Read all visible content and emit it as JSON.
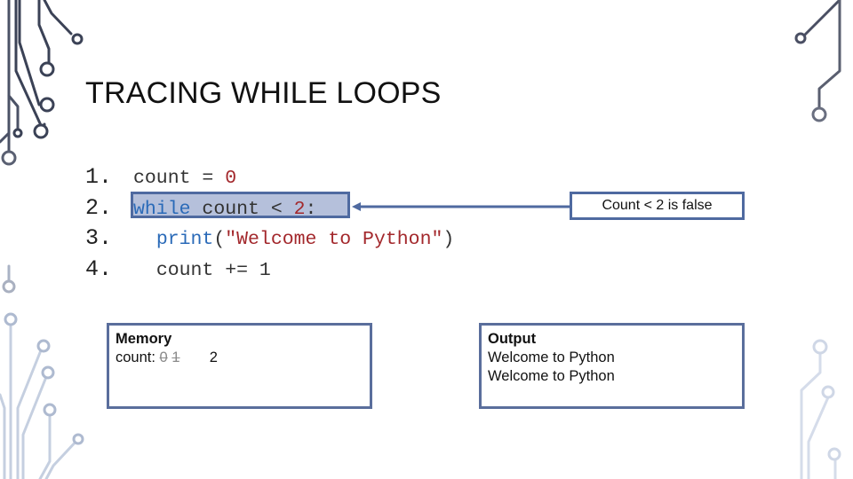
{
  "slide": {
    "title": "TRACING WHILE LOOPS"
  },
  "code": {
    "lines": [
      {
        "number": "1.",
        "indent": "",
        "parts": [
          {
            "text": "count = ",
            "kind": "plain"
          },
          {
            "text": "0",
            "kind": "num"
          }
        ]
      },
      {
        "number": "2.",
        "indent": "",
        "parts": [
          {
            "text": "while",
            "kind": "kw"
          },
          {
            "text": " count < ",
            "kind": "plain"
          },
          {
            "text": "2",
            "kind": "num"
          },
          {
            "text": ":",
            "kind": "plain"
          }
        ]
      },
      {
        "number": "3.",
        "indent": "  ",
        "parts": [
          {
            "text": "print",
            "kind": "kw"
          },
          {
            "text": "(",
            "kind": "plain"
          },
          {
            "text": "\"Welcome to Python\"",
            "kind": "str"
          },
          {
            "text": ")",
            "kind": "plain"
          }
        ]
      },
      {
        "number": "4.",
        "indent": "  ",
        "parts": [
          {
            "text": "count += 1",
            "kind": "plain"
          }
        ]
      }
    ],
    "highlighted_line": 2
  },
  "callout": {
    "text": "Count < 2 is false"
  },
  "memory": {
    "heading": "Memory",
    "label": "count:",
    "old_values": [
      "0",
      "1"
    ],
    "current_value": "2"
  },
  "output": {
    "heading": "Output",
    "lines": [
      "Welcome to Python",
      "Welcome to Python"
    ]
  },
  "colors": {
    "accent": "#4f6aa0",
    "keyword": "#2a6ab8",
    "literal": "#a3282c"
  }
}
